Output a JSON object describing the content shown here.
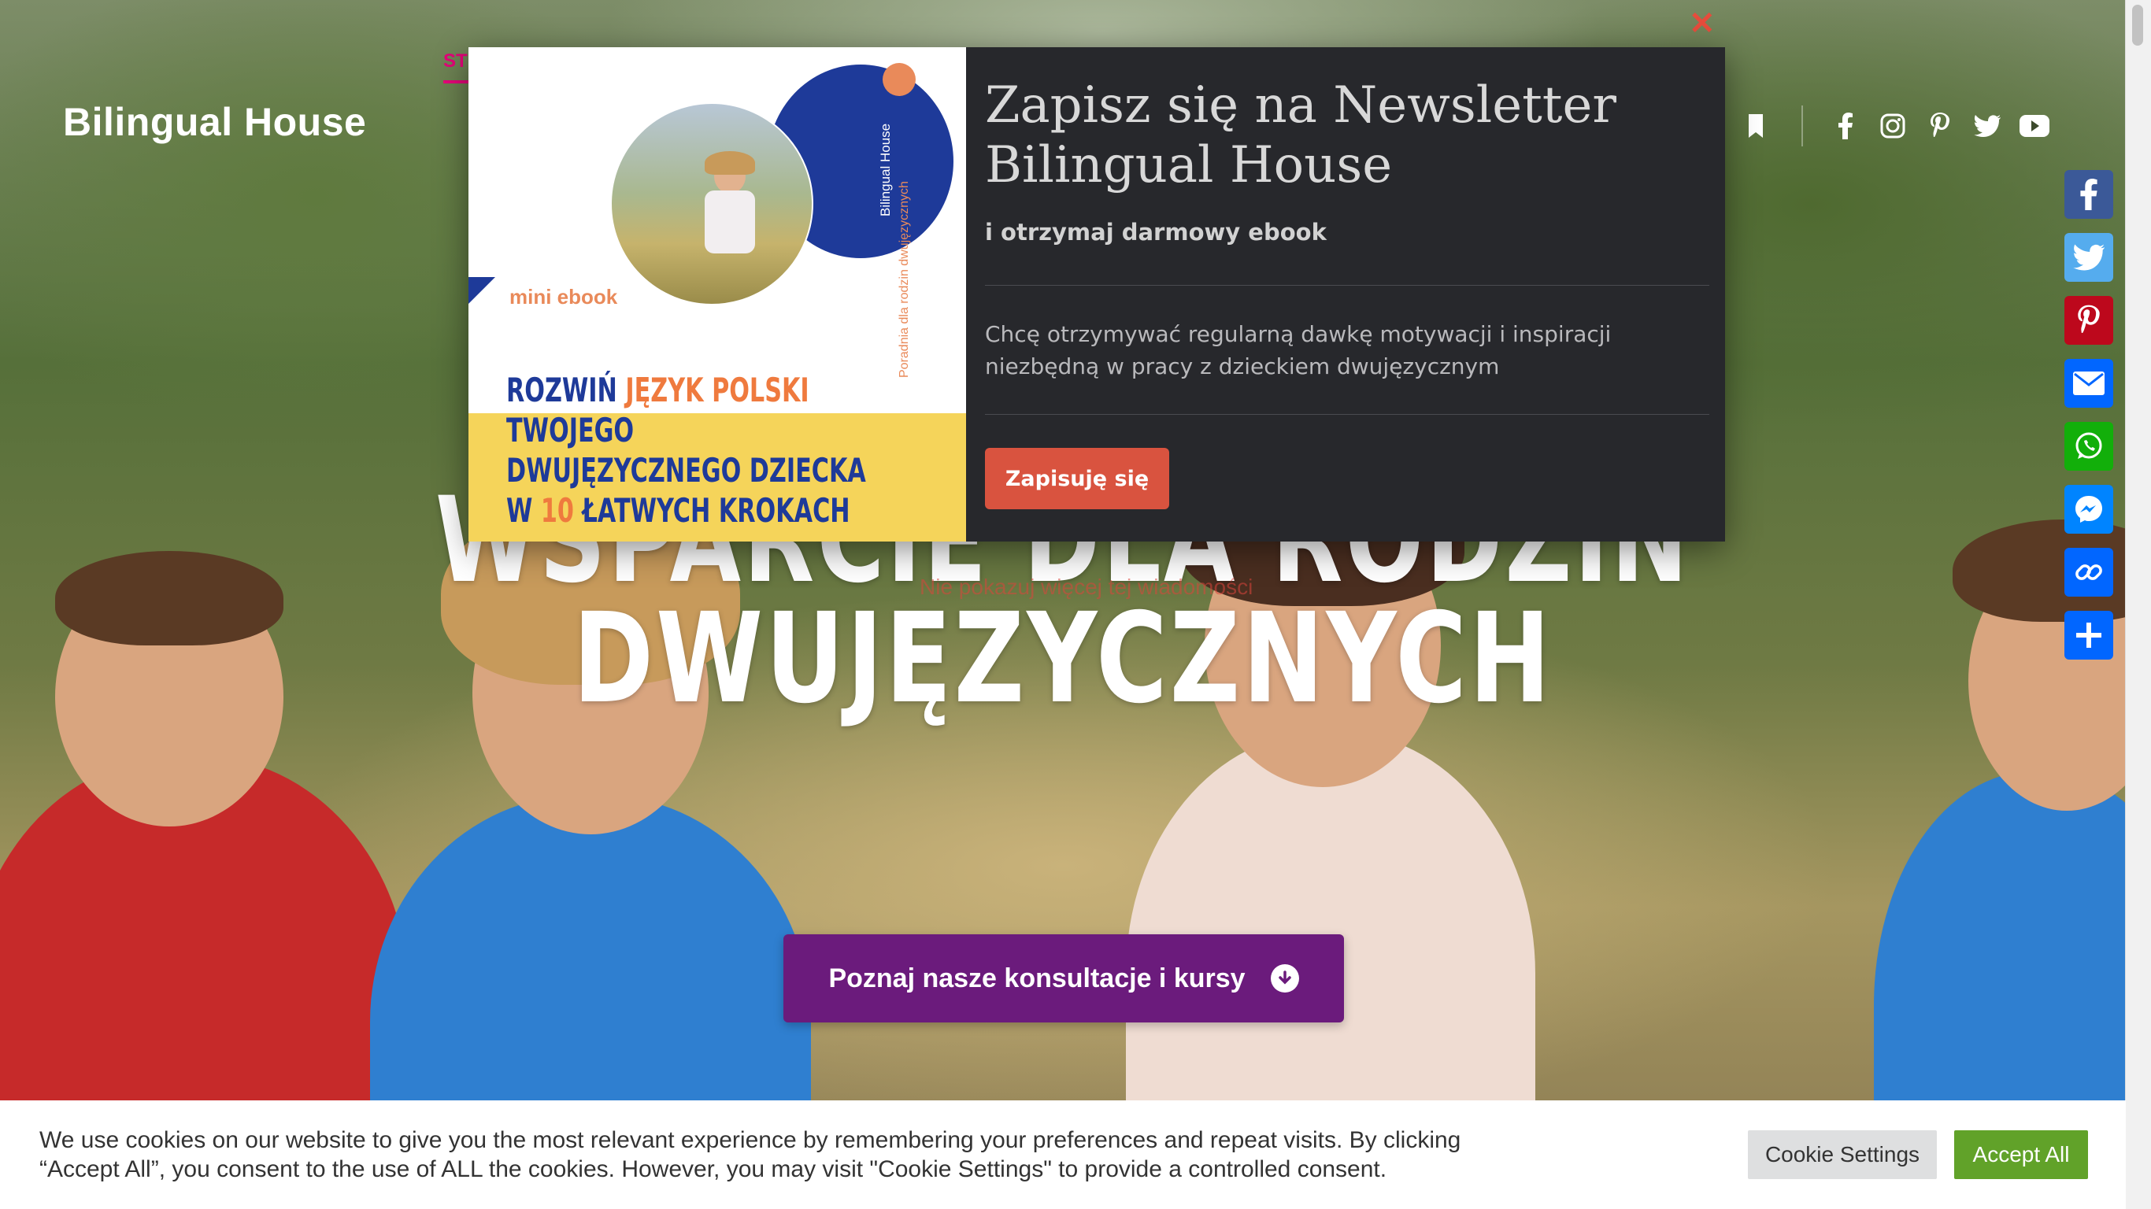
{
  "header": {
    "logo": "Bilingual House",
    "nav_fragment": "ST"
  },
  "hero": {
    "headline_line1": "WSPARCIE DLA RODZIN",
    "headline_line2": "DWUJĘZYCZNYCH",
    "faint_link": "Nie pokazuj więcej tej wiadomości",
    "cta_label": "Poznaj nasze konsultacje i kursy"
  },
  "modal": {
    "close_glyph": "✕",
    "ebook": {
      "mini_label": "mini ebook",
      "vertical_text_1": "Poradnia dla rodzin dwujęzycznych",
      "vertical_text_2": "Bilingual House",
      "title_line1_a": "ROZWIŃ ",
      "title_line1_b": "JĘZYK POLSKI",
      "title_line2": "TWOJEGO",
      "title_line3": "DWUJĘZYCZNEGO DZIECKA",
      "title_line4_a": "W ",
      "title_line4_b": "10",
      "title_line4_c": " ŁATWYCH KROKACH"
    },
    "heading": "Zapisz się na Newsletter Bilingual House",
    "subheading": "i otrzymaj darmowy ebook",
    "description": "Chcę otrzymywać regularną dawkę motywacji i inspiracji niezbędną w pracy z dzieckiem dwujęzycznym",
    "subscribe_label": "Zapisuję się"
  },
  "share": {
    "items": [
      {
        "name": "facebook",
        "color": "#3b5998"
      },
      {
        "name": "twitter",
        "color": "#55acee"
      },
      {
        "name": "pinterest",
        "color": "#bd081c"
      },
      {
        "name": "email",
        "color": "#0166ff"
      },
      {
        "name": "whatsapp",
        "color": "#12af0a"
      },
      {
        "name": "messenger",
        "color": "#0084ff"
      },
      {
        "name": "copy-link",
        "color": "#0166ff"
      },
      {
        "name": "share",
        "color": "#0166ff"
      }
    ]
  },
  "cookie": {
    "text": "We use cookies on our website to give you the most relevant experience by remembering your preferences and repeat visits. By clicking “Accept All”, you consent to the use of ALL the cookies. However, you may visit \"Cookie Settings\" to provide a controlled consent.",
    "settings_label": "Cookie Settings",
    "accept_label": "Accept All"
  },
  "colors": {
    "cta": "#6b1b7c",
    "subscribe": "#d9533f",
    "accept": "#61a229",
    "modal_bg": "#27282c",
    "ebook_blue": "#1e3a99",
    "ebook_orange": "#ef7a3e",
    "ebook_yellow": "#f5d45a"
  }
}
